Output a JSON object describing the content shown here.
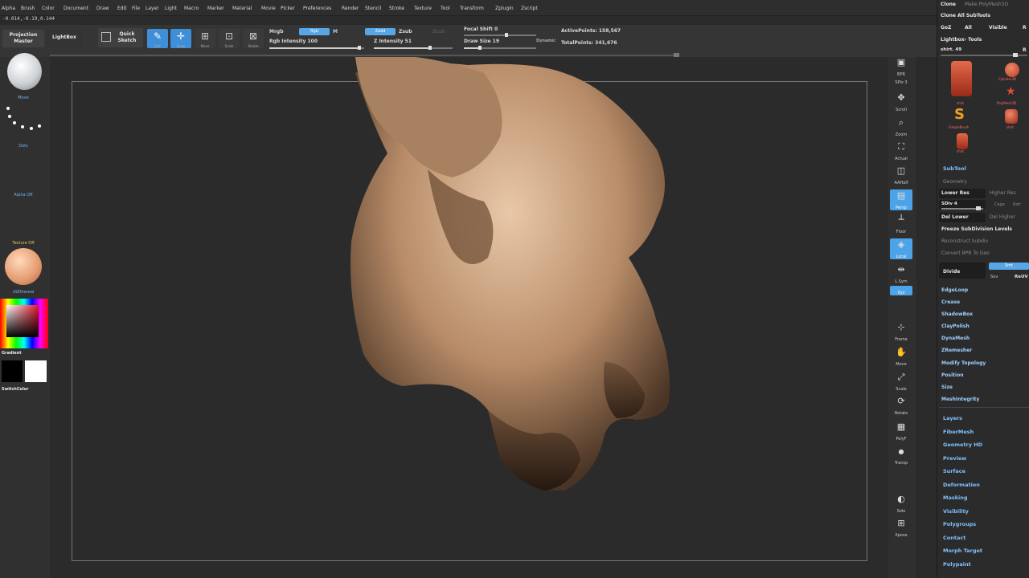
{
  "menu": [
    "Alpha",
    "Brush",
    "Color",
    "Document",
    "Draw",
    "Edit",
    "File",
    "Layer",
    "Light",
    "Macro",
    "Marker",
    "Material",
    "Movie",
    "Picker",
    "Preferences",
    "Render",
    "Stencil",
    "Stroke",
    "Texture",
    "Tool",
    "Transform",
    "Zplugin",
    "Zscript"
  ],
  "coords": "-0.014,-0.19,0.144",
  "shelf": {
    "projection_master": "Projection Master",
    "lightbox": "LightBox",
    "quick_sketch": "Quick Sketch",
    "edit": "Edit",
    "draw": "Draw",
    "move": "Move",
    "scale": "Scale",
    "rotate": "Rotate",
    "mrgb": "Mrgb",
    "rgb": "Rgb",
    "m": "M",
    "zadd": "Zadd",
    "zsub": "Zsub",
    "zcut": "Zcut",
    "rgb_intensity": "Rgb Intensity 100",
    "z_intensity": "Z Intensity 51",
    "focal_shift": "Focal Shift 0",
    "draw_size": "Draw Size 19",
    "dynamic": "Dynamic",
    "active_points": "ActivePoints: 158,567",
    "total_points": "TotalPoints: 341,676"
  },
  "left": {
    "move": "Move",
    "dots": "Dots",
    "alpha_off": "Alpha Off",
    "texture_off": "Texture Off",
    "material": "sSEthereal",
    "gradient": "Gradient",
    "switch_color": "SwitchColor"
  },
  "rightbar": [
    {
      "icon": "▣",
      "label": "BPR",
      "name": "bpr"
    },
    {
      "icon": "",
      "label": "SPix 3",
      "name": "spix"
    },
    {
      "icon": "✥",
      "label": "Scroll",
      "name": "scroll"
    },
    {
      "icon": "⌕",
      "label": "Zoom",
      "name": "zoom"
    },
    {
      "icon": "⛶",
      "label": "Actual",
      "name": "actual"
    },
    {
      "icon": "◫",
      "label": "AAHalf",
      "name": "aahalf"
    },
    {
      "icon": "▤",
      "label": "Persp",
      "name": "persp"
    },
    {
      "icon": "┴",
      "label": "Floor",
      "name": "floor"
    },
    {
      "icon": "◈",
      "label": "Local",
      "name": "local"
    },
    {
      "icon": "⇹",
      "label": "L.Sym",
      "name": "lsym"
    },
    {
      "icon": "◉",
      "label": "Xyz",
      "name": "xyz"
    },
    {
      "icon": "⊹",
      "label": "Frame",
      "name": "frame"
    },
    {
      "icon": "✋",
      "label": "Move",
      "name": "move"
    },
    {
      "icon": "⤢",
      "label": "Scale",
      "name": "scale"
    },
    {
      "icon": "⟳",
      "label": "Rotate",
      "name": "rotate"
    },
    {
      "icon": "▦",
      "label": "PolyF",
      "name": "polyf"
    },
    {
      "icon": "●",
      "label": "Transp",
      "name": "transp"
    },
    {
      "icon": "◐",
      "label": "Solo",
      "name": "solo"
    },
    {
      "icon": "⊞",
      "label": "Xpose",
      "name": "xpose"
    }
  ],
  "tray": {
    "clone": "Clone",
    "make_polymesh": "Make PolyMesh3D",
    "clone_all": "Clone All SubTools",
    "goz": "GoZ",
    "all": "All",
    "visible": "Visible",
    "r": "R",
    "lightbox_tools": "Lightbox› Tools",
    "shirt": "shirt. 49",
    "r2": "R",
    "thumbs": [
      {
        "label": "shirt",
        "name": "shirt-thumb"
      },
      {
        "label": "Cylinder3D",
        "name": "cylinder-thumb"
      },
      {
        "label": "PolyMesh3D",
        "name": "polymesh-thumb"
      },
      {
        "label": "SimpleBrush",
        "name": "simplebrush-thumb"
      },
      {
        "label": "shirt",
        "name": "shirt-thumb-2"
      },
      {
        "label": "shirt",
        "name": "shirt-thumb-3"
      }
    ],
    "subtool": "SubTool",
    "geometry": "Geometry",
    "lower_res": "Lower Res",
    "higher_res": "Higher Res",
    "sdiv": "SDiv 4",
    "cage": "Cage",
    "rstr": "Rstr",
    "del_lower": "Del Lower",
    "del_higher": "Del Higher",
    "freeze": "Freeze SubDivision Levels",
    "reconstruct": "Reconstruct Subdiv",
    "convert_bpr": "Convert BPR To Geo",
    "divide": "Divide",
    "smt": "Smt",
    "suv": "Suv",
    "reuv": "ReUV",
    "items": [
      "EdgeLoop",
      "Crease",
      "ShadowBox",
      "ClayPolish",
      "DynaMesh",
      "ZRemesher",
      "Modify Topology",
      "Position",
      "Size",
      "MeshIntegrity"
    ],
    "sections": [
      "Layers",
      "FiberMesh",
      "Geometry HD",
      "Preview",
      "Surface",
      "Deformation",
      "Masking",
      "Visibility",
      "Polygroups",
      "Contact",
      "Morph Target",
      "Polypaint"
    ]
  }
}
